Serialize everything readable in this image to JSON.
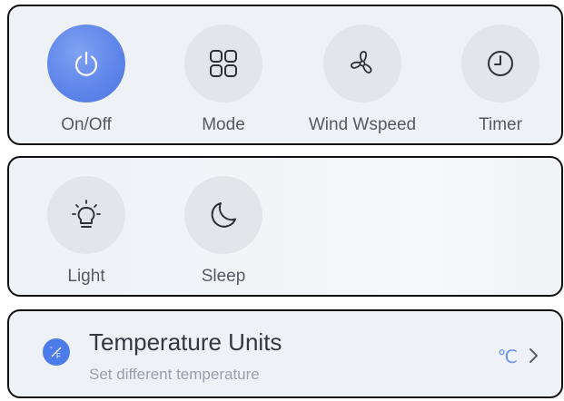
{
  "controls": {
    "items": [
      {
        "label": "On/Off",
        "icon": "power-icon",
        "active": true
      },
      {
        "label": "Mode",
        "icon": "grid-icon"
      },
      {
        "label": "Wind Wspeed",
        "icon": "fan-icon"
      },
      {
        "label": "Timer",
        "icon": "clock-icon"
      }
    ]
  },
  "modes": {
    "items": [
      {
        "label": "Light",
        "icon": "bulb-icon"
      },
      {
        "label": "Sleep",
        "icon": "moon-icon"
      }
    ]
  },
  "temperature_units": {
    "title": "Temperature Units",
    "subtitle": "Set different temperature",
    "value": "℃",
    "icon": "thermometer-units-icon",
    "accent_color": "#4c7bea"
  }
}
